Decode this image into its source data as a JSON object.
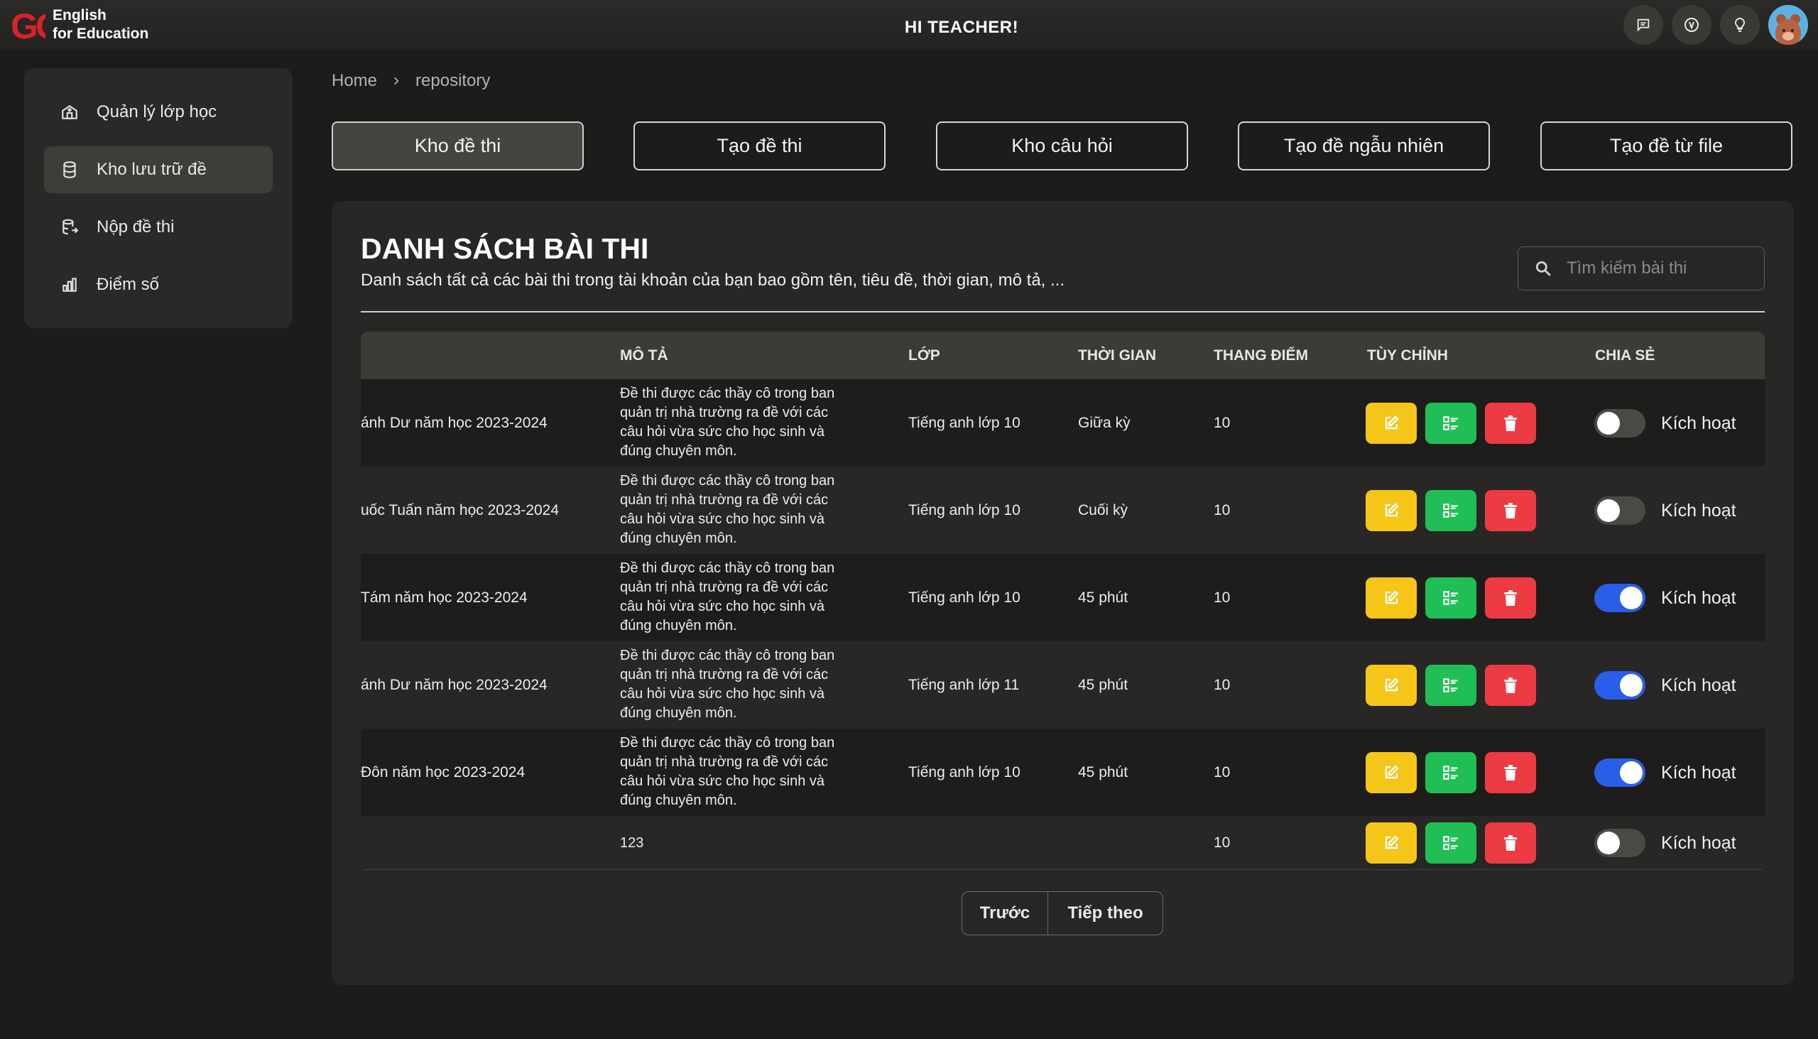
{
  "app": {
    "logo_text": "GO",
    "brand_line1": "English",
    "brand_line2": "for Education",
    "greeting": "HI TEACHER!",
    "header_icons": [
      "message-icon",
      "v-badge-icon",
      "lightbulb-icon"
    ]
  },
  "sidebar": {
    "items": [
      {
        "label": "Quản lý lớp học",
        "icon": "school-icon"
      },
      {
        "label": "Kho lưu trữ đề",
        "icon": "database-icon"
      },
      {
        "label": "Nộp đề thi",
        "icon": "database-upload-icon"
      },
      {
        "label": "Điểm số",
        "icon": "bar-chart-icon"
      }
    ]
  },
  "breadcrumb": {
    "home": "Home",
    "current": "repository"
  },
  "tabs": [
    {
      "label": "Kho đề thi"
    },
    {
      "label": "Tạo đề thi"
    },
    {
      "label": "Kho câu hỏi"
    },
    {
      "label": "Tạo đề ngẫu nhiên"
    },
    {
      "label": "Tạo đề từ file"
    }
  ],
  "main": {
    "title": "DANH SÁCH BÀI THI",
    "subtitle": "Danh sách tất cả các bài thi trong tài khoản của bạn bao gồm tên, tiêu đề, thời gian, mô tả, ...",
    "search_placeholder": "Tìm kiếm bài thi"
  },
  "table": {
    "headers": {
      "desc": "MÔ TẢ",
      "class": "LỚP",
      "time": "THỜI GIAN",
      "scale": "THANG ĐIỂM",
      "custom": "TÙY CHỈNH",
      "share": "CHIA SẺ"
    },
    "rows": [
      {
        "name": "ánh Dư năm học 2023-2024",
        "desc": "Đề thi được các thầy cô trong ban quản trị nhà trường ra đề với các câu hỏi vừa sức cho học sinh và đúng chuyên môn.",
        "class": "Tiếng anh lớp 10",
        "time": "Giữa kỳ",
        "scale": "10",
        "shared": false,
        "share_label": "Kích hoạt"
      },
      {
        "name": "uốc Tuấn năm học 2023-2024",
        "desc": "Đề thi được các thầy cô trong ban quản trị nhà trường ra đề với các câu hỏi vừa sức cho học sinh và đúng chuyên môn.",
        "class": "Tiếng anh lớp 10",
        "time": "Cuối kỳ",
        "scale": "10",
        "shared": false,
        "share_label": "Kích hoạt"
      },
      {
        "name": "Tám năm học 2023-2024",
        "desc": "Đề thi được các thầy cô trong ban quản trị nhà trường ra đề với các câu hỏi vừa sức cho học sinh và đúng chuyên môn.",
        "class": "Tiếng anh lớp 10",
        "time": "45 phút",
        "scale": "10",
        "shared": true,
        "share_label": "Kích hoạt"
      },
      {
        "name": "ánh Dư năm học 2023-2024",
        "desc": "Đề thi được các thầy cô trong ban quản trị nhà trường ra đề với các câu hỏi vừa sức cho học sinh và đúng chuyên môn.",
        "class": "Tiếng anh lớp 11",
        "time": "45 phút",
        "scale": "10",
        "shared": true,
        "share_label": "Kích hoạt"
      },
      {
        "name": "Đôn năm học 2023-2024",
        "desc": "Đề thi được các thầy cô trong ban quản trị nhà trường ra đề với các câu hỏi vừa sức cho học sinh và đúng chuyên môn.",
        "class": "Tiếng anh lớp 10",
        "time": "45 phút",
        "scale": "10",
        "shared": true,
        "share_label": "Kích hoạt"
      },
      {
        "name": "",
        "desc": "123",
        "class": "",
        "time": "",
        "scale": "10",
        "shared": false,
        "share_label": "Kích hoạt"
      }
    ]
  },
  "pagination": {
    "prev": "Trước",
    "next": "Tiếp theo"
  }
}
